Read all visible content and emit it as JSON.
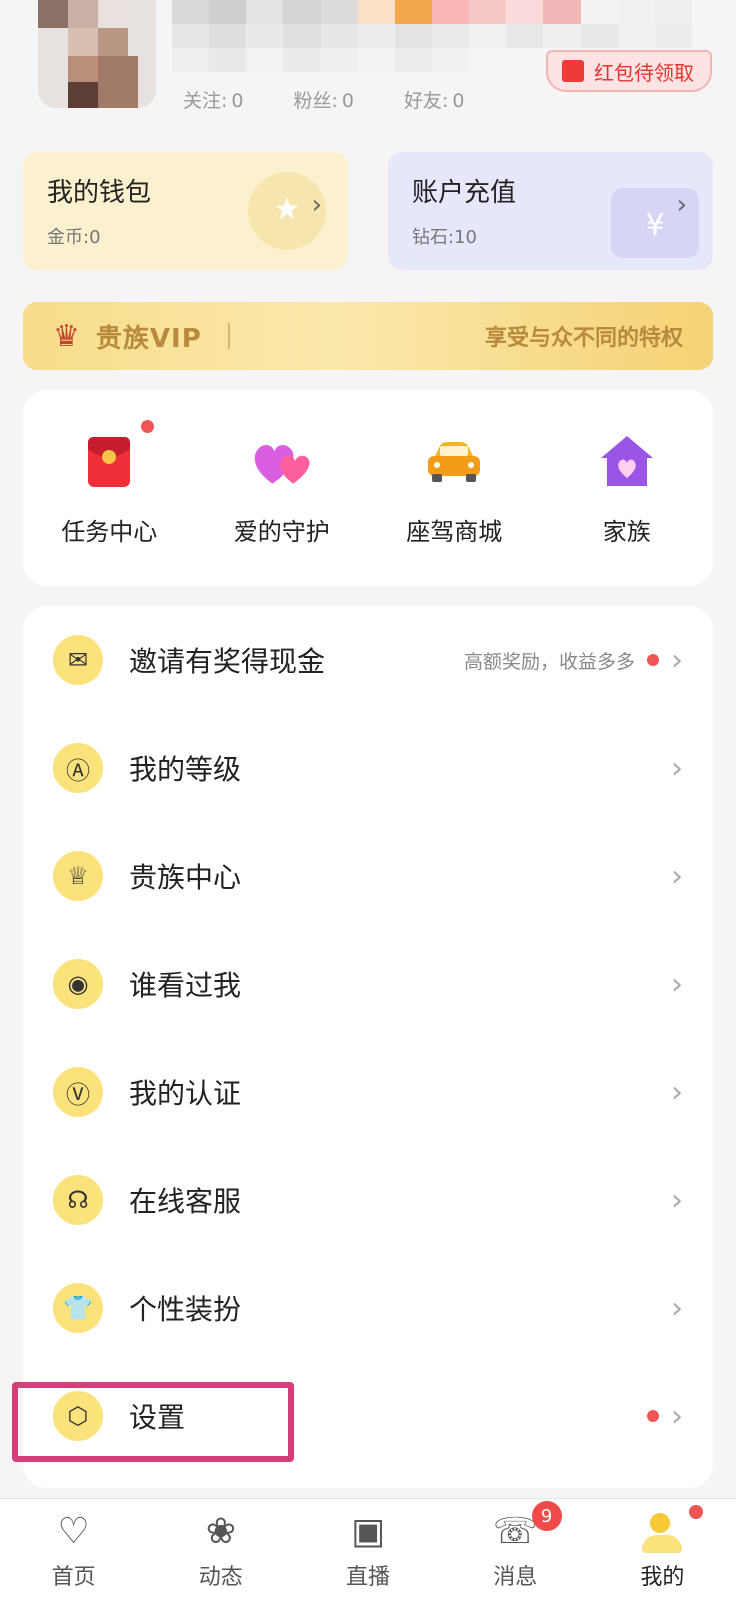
{
  "profile": {
    "stats": [
      {
        "label": "关注:",
        "value": "0"
      },
      {
        "label": "粉丝:",
        "value": "0"
      },
      {
        "label": "好友:",
        "value": "0"
      }
    ],
    "reward_badge": "红包待领取"
  },
  "cards": {
    "wallet": {
      "title": "我的钱包",
      "sub": "金币:0"
    },
    "recharge": {
      "title": "账户充值",
      "sub": "钻石:10"
    }
  },
  "vip": {
    "title": "贵族VIP",
    "slogan": "享受与众不同的特权"
  },
  "grid": [
    {
      "label": "任务中心",
      "icon": "red-envelope-icon",
      "dot": true
    },
    {
      "label": "爱的守护",
      "icon": "hearts-icon",
      "dot": false
    },
    {
      "label": "座驾商城",
      "icon": "car-icon",
      "dot": false
    },
    {
      "label": "家族",
      "icon": "house-heart-icon",
      "dot": false
    }
  ],
  "menu": [
    {
      "label": "邀请有奖得现金",
      "sub": "高额奖励，收益多多",
      "icon": "envelope-icon",
      "dot": true
    },
    {
      "label": "我的等级",
      "sub": "",
      "icon": "level-medal-icon",
      "dot": false
    },
    {
      "label": "贵族中心",
      "sub": "",
      "icon": "crown-icon",
      "dot": false
    },
    {
      "label": "谁看过我",
      "sub": "",
      "icon": "eye-icon",
      "dot": false
    },
    {
      "label": "我的认证",
      "sub": "",
      "icon": "verified-v-icon",
      "dot": false
    },
    {
      "label": "在线客服",
      "sub": "",
      "icon": "headset-icon",
      "dot": false
    },
    {
      "label": "个性装扮",
      "sub": "",
      "icon": "tshirt-icon",
      "dot": false
    },
    {
      "label": "设置",
      "sub": "",
      "icon": "settings-hexagon-icon",
      "dot": true
    }
  ],
  "nav": [
    {
      "label": "首页",
      "icon": "heart-home-icon"
    },
    {
      "label": "动态",
      "icon": "bouquet-icon"
    },
    {
      "label": "直播",
      "icon": "live-tv-icon"
    },
    {
      "label": "消息",
      "icon": "chat-bubble-icon",
      "badge": "9"
    },
    {
      "label": "我的",
      "icon": "me-icon",
      "active": true
    }
  ],
  "colors": {
    "accent_yellow": "#fbe27a",
    "highlight": "#d63e7a",
    "dot_red": "#f05555"
  }
}
